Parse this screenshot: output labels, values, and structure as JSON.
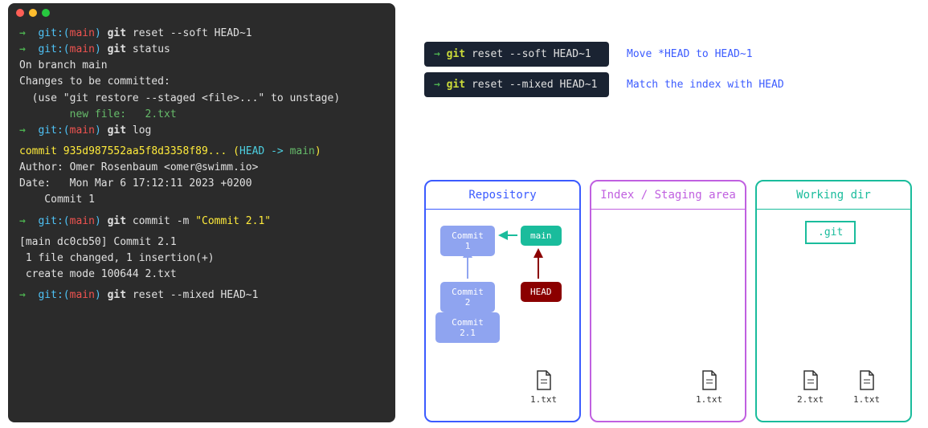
{
  "terminal": {
    "lines": [
      {
        "type": "prompt",
        "cmd": "git reset --soft HEAD~1"
      },
      {
        "type": "prompt",
        "cmd": "git status"
      },
      {
        "type": "out",
        "text": "On branch main"
      },
      {
        "type": "out",
        "text": "Changes to be committed:"
      },
      {
        "type": "out",
        "text": "  (use \"git restore --staged <file>...\" to unstage)"
      },
      {
        "type": "newfile",
        "text": "        new file:   2.txt"
      },
      {
        "type": "prompt",
        "cmd": "git log"
      },
      {
        "type": "gap"
      },
      {
        "type": "commitline",
        "hash": "commit 935d987552aa5f8d3358f89...",
        "ref": " (",
        "head": "HEAD -> ",
        "main": "main",
        "close": ")"
      },
      {
        "type": "out",
        "text": "Author: Omer Rosenbaum <omer@swimm.io>"
      },
      {
        "type": "out",
        "text": "Date:   Mon Mar 6 17:12:11 2023 +0200"
      },
      {
        "type": "out",
        "text": "    Commit 1"
      },
      {
        "type": "gap"
      },
      {
        "type": "prompt",
        "cmd": "git commit -m ",
        "quoted": "\"Commit 2.1\""
      },
      {
        "type": "gap"
      },
      {
        "type": "out",
        "text": "[main dc0cb50] Commit 2.1"
      },
      {
        "type": "out",
        "text": " 1 file changed, 1 insertion(+)"
      },
      {
        "type": "out",
        "text": " create mode 100644 2.txt"
      },
      {
        "type": "gap"
      },
      {
        "type": "prompt",
        "cmd": "git reset --mixed HEAD~1"
      }
    ],
    "prompt_git": "git:(",
    "prompt_branch": "main",
    "prompt_close": ")",
    "git_prefix": "git "
  },
  "cmd1": {
    "arrow": "→",
    "git": "git",
    "rest": " reset --soft HEAD~1",
    "explain": "Move *HEAD to HEAD~1"
  },
  "cmd2": {
    "arrow": "→",
    "git": "git",
    "rest": " reset --mixed HEAD~1",
    "explain": "Match the index with HEAD"
  },
  "panels": {
    "repo": {
      "title": "Repository",
      "c1": "Commit 1",
      "c2": "Commit 2",
      "c21": "Commit 2.1",
      "main": "main",
      "head": "HEAD",
      "file": "1.txt"
    },
    "index": {
      "title": "Index / Staging area",
      "file": "1.txt"
    },
    "wd": {
      "title": "Working dir",
      "gitfolder": ".git",
      "file1": "2.txt",
      "file2": "1.txt"
    }
  }
}
